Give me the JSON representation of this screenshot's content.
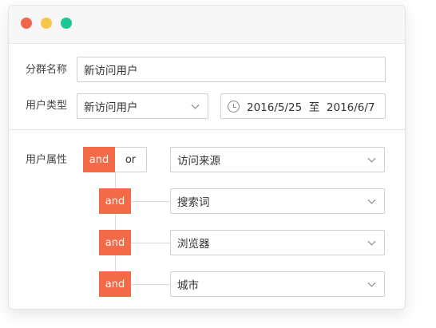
{
  "window": {
    "controls": [
      "close",
      "minimize",
      "maximize"
    ]
  },
  "form": {
    "group_name_label": "分群名称",
    "group_name_value": "新访问用户",
    "user_type_label": "用户类型",
    "user_type_value": "新访问用户",
    "date_range_value": "2016/5/25  至  2016/6/7",
    "user_attr_label": "用户属性"
  },
  "logic": {
    "and_label": "and",
    "or_label": "or"
  },
  "conditions": [
    {
      "operator": "and",
      "field": "访问来源"
    },
    {
      "operator": "and",
      "field": "搜索词"
    },
    {
      "operator": "and",
      "field": "浏览器"
    },
    {
      "operator": "and",
      "field": "城市"
    }
  ],
  "colors": {
    "accent": "#f26a47",
    "close": "#f2664d",
    "minimize": "#f7c64c",
    "maximize": "#1cc592"
  }
}
